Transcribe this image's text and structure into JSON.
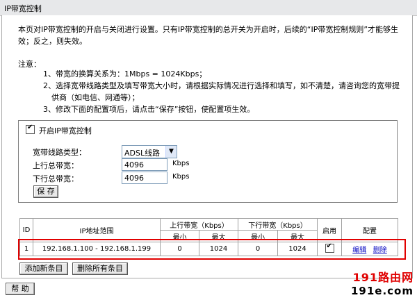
{
  "title": "IP带宽控制",
  "intro": "本页对IP带宽控制的开启与关闭进行设置。只有IP带宽控制的总开关为开启时，后续的“IP带宽控制规则”才能够生效；反之，则失效。",
  "notes": {
    "heading": "注意：",
    "items": [
      "1、带宽的换算关系为：1Mbps = 1024Kbps；",
      "2、选择宽带线路类型及填写带宽大小时，请根据实际情况进行选择和填写，如不清楚，请咨询您的宽带提",
      "供商（如电信、网通等）；",
      "3、修改下面的配置项后，请点击“保存”按钮，使配置项生效。"
    ]
  },
  "enable": {
    "label": "开启IP带宽控制",
    "checked": true
  },
  "settings": {
    "line_type_label": "宽带线路类型：",
    "line_type_value": "ADSL线路",
    "up_label": "上行总带宽：",
    "up_value": "4096",
    "down_label": "下行总带宽：",
    "down_value": "4096",
    "unit": "Kbps",
    "save": "保 存"
  },
  "table": {
    "headers": {
      "id": "ID",
      "ip": "IP地址范围",
      "up": "上行带宽（Kbps）",
      "down": "下行带宽（Kbps）",
      "enable": "启用",
      "config": "配置",
      "min": "最小",
      "max": "最大"
    },
    "rows": [
      {
        "id": "1",
        "ip": "192.168.1.100 - 192.168.1.199",
        "up_min": "0",
        "up_max": "1024",
        "down_min": "0",
        "down_max": "1024",
        "enabled": true,
        "edit": "编辑",
        "delete": "删除"
      }
    ]
  },
  "buttons": {
    "add": "添加新条目",
    "delete_all": "删除所有条目",
    "help": "帮 助"
  },
  "watermark": {
    "line1": "191路由网",
    "line2": "191e.com"
  }
}
